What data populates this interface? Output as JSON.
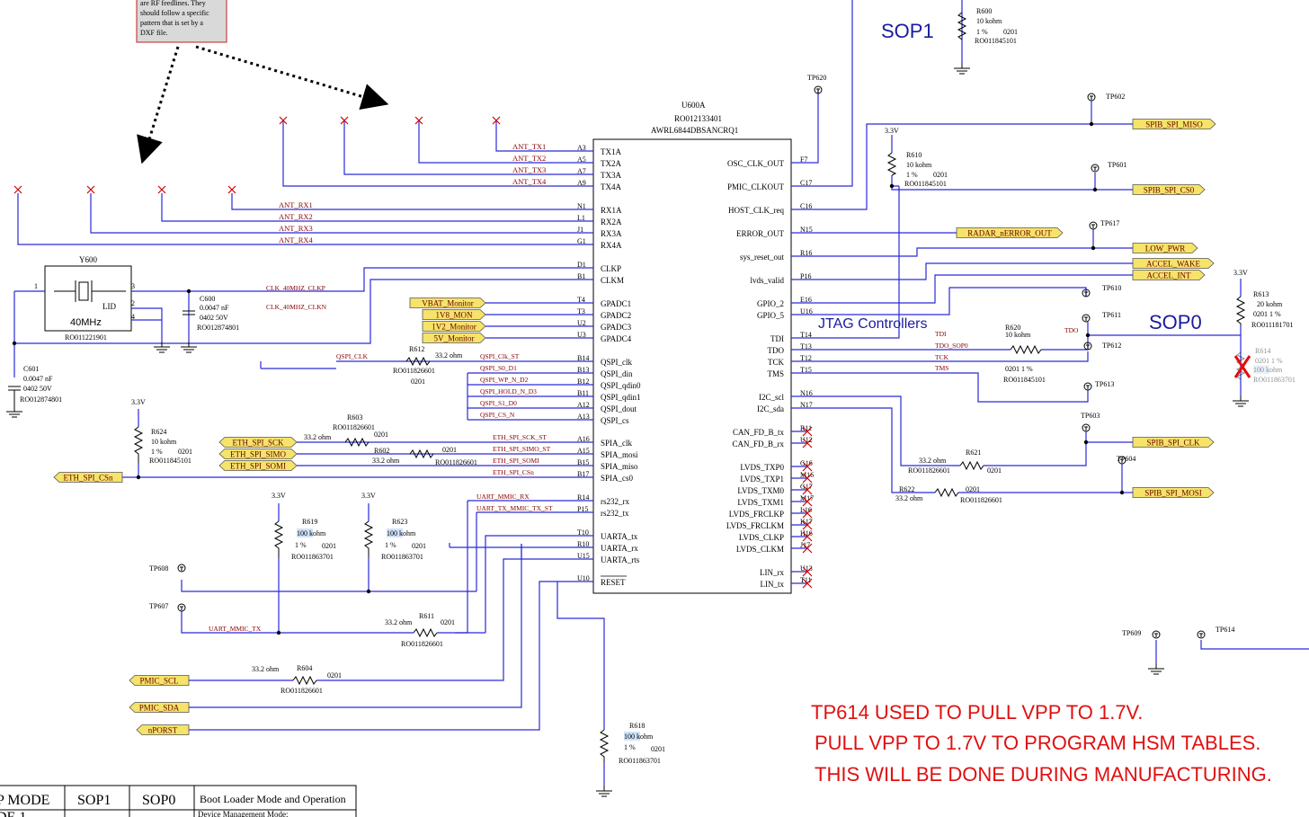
{
  "ic": {
    "ref": "U600A",
    "part": "RO012133401",
    "name": "AWRL6844DBSANCRQ1"
  },
  "sop_labels": {
    "sop1": "SOP1",
    "sop0": "SOP0",
    "jtag": "JTAG Controllers"
  },
  "note_box": [
    "are RF feedlines. They",
    "should  follow a specific",
    "pattern that is set by a",
    "DXF file."
  ],
  "left_pins": [
    {
      "num": "A3",
      "name": "TX1A",
      "net": "ANT_TX1"
    },
    {
      "num": "A5",
      "name": "TX2A",
      "net": "ANT_TX2"
    },
    {
      "num": "A7",
      "name": "TX3A",
      "net": "ANT_TX3"
    },
    {
      "num": "A9",
      "name": "TX4A",
      "net": "ANT_TX4"
    },
    {
      "num": "N1",
      "name": "RX1A",
      "net": "ANT_RX1"
    },
    {
      "num": "L1",
      "name": "RX2A",
      "net": "ANT_RX2"
    },
    {
      "num": "J1",
      "name": "RX3A",
      "net": "ANT_RX3"
    },
    {
      "num": "G1",
      "name": "RX4A",
      "net": "ANT_RX4"
    },
    {
      "num": "D1",
      "name": "CLKP",
      "net": ""
    },
    {
      "num": "B1",
      "name": "CLKM",
      "net": ""
    },
    {
      "num": "T4",
      "name": "GPADC1",
      "net": ""
    },
    {
      "num": "T3",
      "name": "GPADC2",
      "net": ""
    },
    {
      "num": "U2",
      "name": "GPADC3",
      "net": ""
    },
    {
      "num": "U3",
      "name": "GPADC4",
      "net": ""
    },
    {
      "num": "B14",
      "name": "QSPI_clk",
      "net": "QSPI_Clk_ST"
    },
    {
      "num": "B13",
      "name": "QSPI_din",
      "net": "QSPI_S0_D1"
    },
    {
      "num": "B12",
      "name": "QSPI_qdin0",
      "net": "QSPI_WP_N_D2"
    },
    {
      "num": "B11",
      "name": "QSPI_qdin1",
      "net": "QSPI_HOLD_N_D3"
    },
    {
      "num": "A12",
      "name": "QSPI_dout",
      "net": "QSPI_S1_D0"
    },
    {
      "num": "A13",
      "name": "QSPI_cs",
      "net": "QSPI_CS_N"
    },
    {
      "num": "A16",
      "name": "SPIA_clk",
      "net": "ETH_SPI_SCK_ST"
    },
    {
      "num": "A15",
      "name": "SPIA_mosi",
      "net": "ETH_SPI_SIMO_ST"
    },
    {
      "num": "B15",
      "name": "SPIA_miso",
      "net": "ETH_SPI_SOMI"
    },
    {
      "num": "B17",
      "name": "SPIA_cs0",
      "net": "ETH_SPI_CSn"
    },
    {
      "num": "R14",
      "name": "rs232_rx",
      "net": "UART_MMIC_RX"
    },
    {
      "num": "P15",
      "name": "rs232_tx",
      "net": "UART_TX_MMIC_TX_ST"
    },
    {
      "num": "T10",
      "name": "UARTA_tx",
      "net": ""
    },
    {
      "num": "R10",
      "name": "UARTA_rx",
      "net": ""
    },
    {
      "num": "U15",
      "name": "UARTA_rts",
      "net": ""
    },
    {
      "num": "U10",
      "name": "RESET",
      "net": ""
    }
  ],
  "right_pins": [
    {
      "num": "F7",
      "name": "OSC_CLK_OUT"
    },
    {
      "num": "C17",
      "name": "PMIC_CLKOUT"
    },
    {
      "num": "C16",
      "name": "HOST_CLK_req"
    },
    {
      "num": "N15",
      "name": "ERROR_OUT"
    },
    {
      "num": "R16",
      "name": "sys_reset_out"
    },
    {
      "num": "P16",
      "name": "lvds_valid"
    },
    {
      "num": "E16",
      "name": "GPIO_2"
    },
    {
      "num": "U16",
      "name": "GPIO_5"
    },
    {
      "num": "T14",
      "name": "TDI"
    },
    {
      "num": "T13",
      "name": "TDO"
    },
    {
      "num": "T12",
      "name": "TCK"
    },
    {
      "num": "T15",
      "name": "TMS"
    },
    {
      "num": "N16",
      "name": "I2C_scl"
    },
    {
      "num": "N17",
      "name": "I2C_sda"
    },
    {
      "num": "R11",
      "name": "CAN_FD_B_tx"
    },
    {
      "num": "U12",
      "name": "CAN_FD_B_rx"
    },
    {
      "num": "G16",
      "name": "LVDS_TXP0"
    },
    {
      "num": "M16",
      "name": "LVDS_TXP1"
    },
    {
      "num": "G17",
      "name": "LVDS_TXM0"
    },
    {
      "num": "M17",
      "name": "LVDS_TXM1"
    },
    {
      "num": "L16",
      "name": "LVDS_FRCLKP"
    },
    {
      "num": "K17",
      "name": "LVDS_FRCLKM"
    },
    {
      "num": "H16",
      "name": "LVDS_CLKP"
    },
    {
      "num": "J17",
      "name": "LVDS_CLKM"
    },
    {
      "num": "U13",
      "name": "LIN_rx"
    },
    {
      "num": "T11",
      "name": "LIN_tx"
    }
  ],
  "right_nets": {
    "tdi": "TDI",
    "tdo": "TDO_SOP0",
    "tck": "TCK",
    "tms": "TMS",
    "tdo2": "TDO"
  },
  "ports": {
    "spib_miso": "SPIB_SPI_MISO",
    "spib_cs0": "SPIB_SPI_CS0",
    "radar_err": "RADAR_nERROR_OUT",
    "low_pwr": "LOW_PWR",
    "accel_wake": "ACCEL_WAKE",
    "accel_int": "ACCEL_INT",
    "spib_clk": "SPIB_SPI_CLK",
    "spib_mosi": "SPIB_SPI_MOSI",
    "vbat": "VBAT_Monitor",
    "v1v8": "1V8_MON",
    "v1v2": "1V2_Monitor",
    "v5": "5V_Monitor",
    "eth_sck": "ETH_SPI_SCK",
    "eth_simo": "ETH_SPI_SIMO",
    "eth_somi": "ETH_SPI_SOMI",
    "eth_csn": "ETH_SPI_CSn",
    "pmic_scl": "PMIC_SCL",
    "pmic_sda": "PMIC_SDA",
    "nporst": "nPORST"
  },
  "testpoints": {
    "tp620": "TP620",
    "tp602": "TP602",
    "tp601": "TP601",
    "tp617": "TP617",
    "tp610": "TP610",
    "tp611": "TP611",
    "tp612": "TP612",
    "tp613": "TP613",
    "tp603": "TP603",
    "tp604": "TP604",
    "tp608": "TP608",
    "tp607": "TP607",
    "tp609": "TP609",
    "tp614": "TP614"
  },
  "parts": {
    "r600": {
      "ref": "R600",
      "val": "10 kohm",
      "tol": "1 %",
      "pkg": "0201",
      "pn": "RO011845101"
    },
    "r610": {
      "ref": "R610",
      "val": "10 kohm",
      "tol": "1 %",
      "pkg": "0201",
      "pn": "RO011845101"
    },
    "r613": {
      "ref": "R613",
      "val": "20 kohm",
      "tol": "0201  1 %",
      "pn": "RO011181701"
    },
    "r614": {
      "ref": "R614",
      "tol": "0201  1 %",
      "val": "100 kohm",
      "pn": "RO011863701"
    },
    "r620": {
      "ref": "R620",
      "val": "10 kohm",
      "tol": "0201  1 %",
      "pn": "RO011845101"
    },
    "r621": {
      "ref": "R621",
      "val": "33.2 ohm",
      "pkg": "0201",
      "pn": "RO011826601"
    },
    "r622": {
      "ref": "R622",
      "val": "33.2 ohm",
      "pkg": "0201",
      "pn": "RO011826601"
    },
    "r612": {
      "ref": "R612",
      "val": "33.2 ohm",
      "pkg": "0201",
      "pn": "RO011826601"
    },
    "r603": {
      "ref": "R603",
      "val": "33.2 ohm",
      "pkg": "0201",
      "pn": "RO011826601"
    },
    "r602": {
      "ref": "R602",
      "val": "33.2 ohm",
      "pkg": "0201",
      "pn": "RO011826601"
    },
    "r624": {
      "ref": "R624",
      "val": "10 kohm",
      "tol": "1 %",
      "pkg": "0201",
      "pn": "RO011845101"
    },
    "r619": {
      "ref": "R619",
      "val": "100 kohm",
      "tol": "1 %",
      "pkg": "0201",
      "pn": "RO011863701"
    },
    "r623": {
      "ref": "R623",
      "val": "100 kohm",
      "tol": "1 %",
      "pkg": "0201",
      "pn": "RO011863701"
    },
    "r611": {
      "ref": "R611",
      "val": "33.2 ohm",
      "pkg": "0201",
      "pn": "RO011826601"
    },
    "r604": {
      "ref": "R604",
      "val": "33.2 ohm",
      "pkg": "0201",
      "pn": "RO011826601"
    },
    "r618": {
      "ref": "R618",
      "val": "100 kohm",
      "tol": "1 %",
      "pkg": "0201",
      "pn": "RO011863701"
    },
    "c600": {
      "ref": "C600",
      "val": "0.0047 nF",
      "pkg": "0402  50V",
      "pn": "RO012874801"
    },
    "c601": {
      "ref": "C601",
      "val": "0.0047 nF",
      "pkg": "0402  50V",
      "pn": "RO012874801"
    },
    "y600": {
      "ref": "Y600",
      "freq": "40MHz",
      "lid": "LID",
      "pn": "RO011221901"
    }
  },
  "clk_nets": {
    "p": "CLK_40MHZ_CLKP",
    "n": "CLK_40MHZ_CLKN"
  },
  "uart_nets": {
    "tx": "UART_MMIC_TX",
    "qspi_clk": "QSPI_CLK"
  },
  "rail": "3.3V",
  "notes": [
    "TP614 USED TO PULL VPP TO 1.7V.",
    "PULL VPP TO 1.7V TO PROGRAM HSM TABLES.",
    "THIS WILL BE DONE DURING MANUFACTURING."
  ],
  "table": {
    "headers": [
      "P MODE",
      "SOP1",
      "SOP0",
      "Boot Loader Mode and Operation"
    ],
    "row1": [
      "DE 1",
      "",
      "",
      "Device Management Mode:"
    ]
  }
}
